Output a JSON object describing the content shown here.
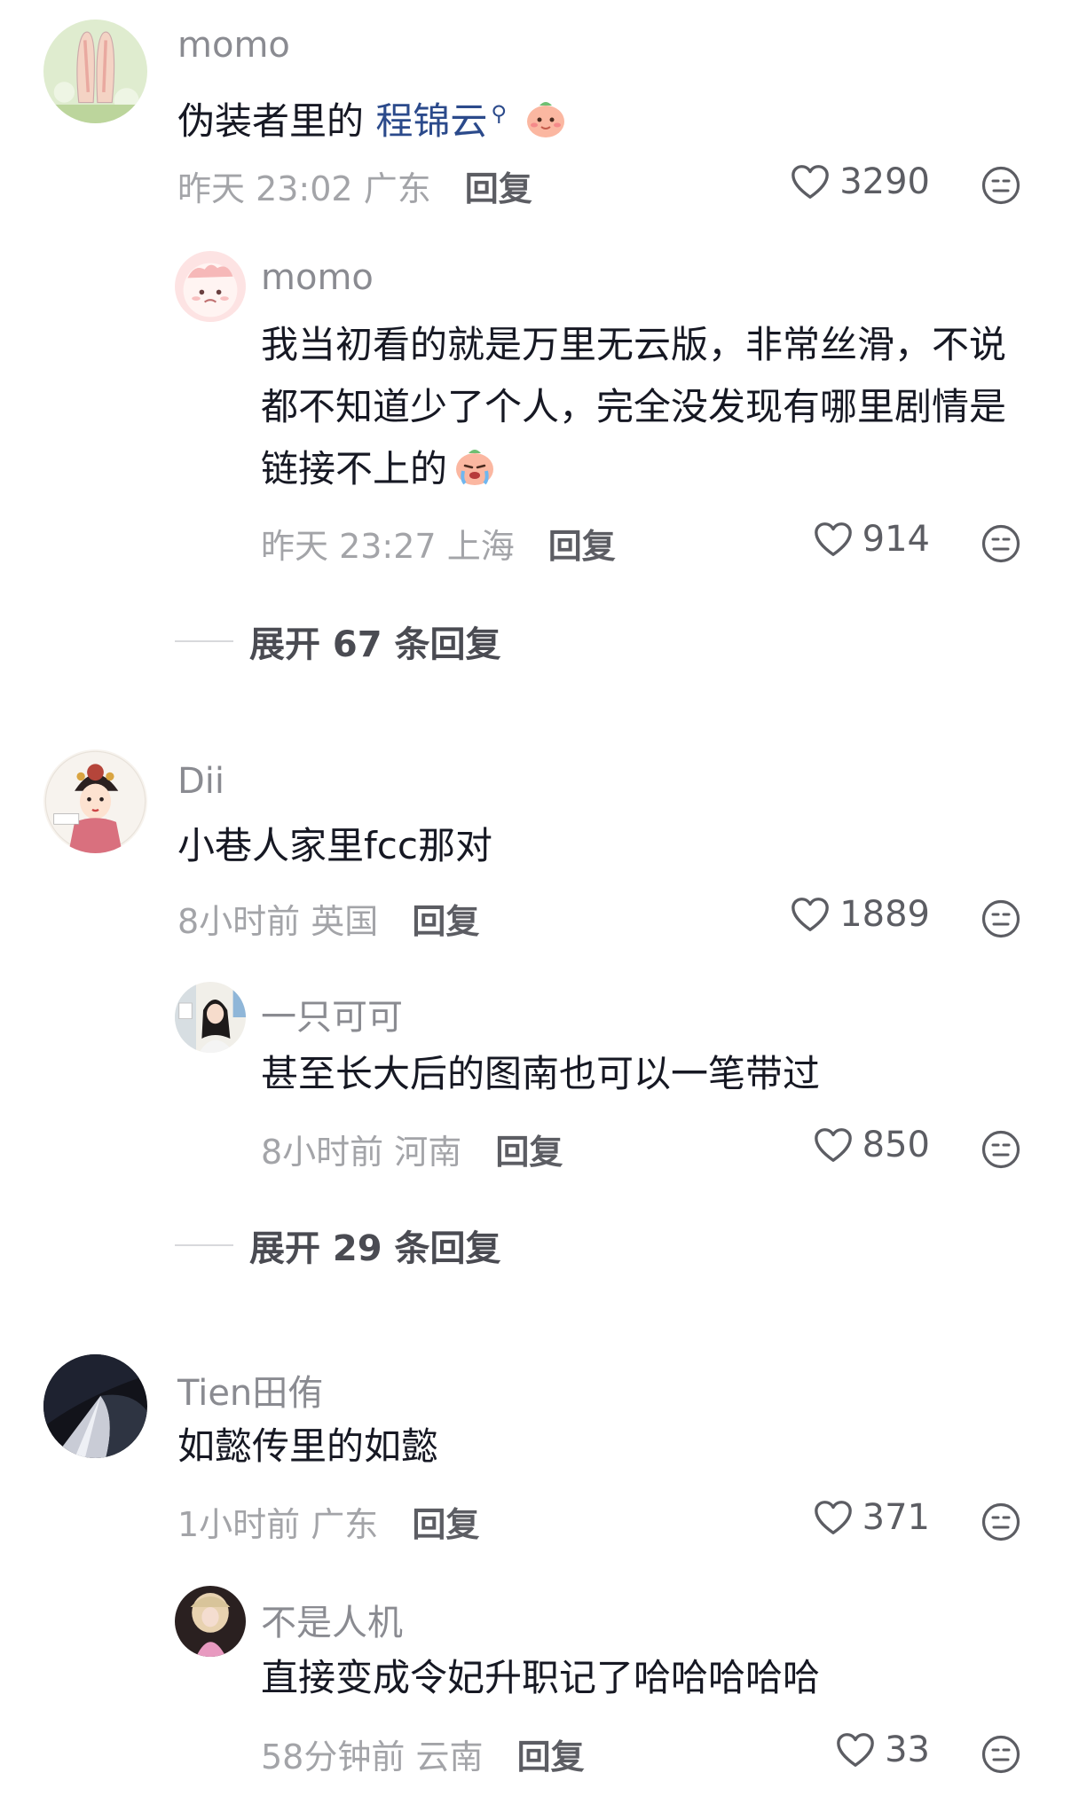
{
  "comments": [
    {
      "username": "momo",
      "text_plain": "伪装者里的 ",
      "mention": "程锦云",
      "time": "昨天 23:02",
      "location": "广东",
      "reply_label": "回复",
      "likes": "3290",
      "replies": [
        {
          "username": "momo",
          "text": "我当初看的就是万里无云版，非常丝滑，不说都不知道少了个人，完全没发现有哪里剧情是链接不上的",
          "time": "昨天 23:27",
          "location": "上海",
          "reply_label": "回复",
          "likes": "914"
        }
      ],
      "expand_label": "展开 67 条回复"
    },
    {
      "username": "Dii",
      "text": "小巷人家里fcc那对",
      "time": "8小时前",
      "location": "英国",
      "reply_label": "回复",
      "likes": "1889",
      "replies": [
        {
          "username": "一只可可",
          "text": "甚至长大后的图南也可以一笔带过",
          "time": "8小时前",
          "location": "河南",
          "reply_label": "回复",
          "likes": "850"
        }
      ],
      "expand_label": "展开 29 条回复"
    },
    {
      "username": "Tien田侑",
      "text": "如懿传里的如懿",
      "time": "1小时前",
      "location": "广东",
      "reply_label": "回复",
      "likes": "371",
      "replies": [
        {
          "username": "不是人机",
          "text": "直接变成令妃升职记了哈哈哈哈哈",
          "time": "58分钟前",
          "location": "云南",
          "reply_label": "回复",
          "likes": "33"
        }
      ]
    }
  ],
  "icons": {
    "like": "heart-outline-icon",
    "dislike": "neutral-face-icon",
    "search": "search-icon",
    "emoji": "blush-face-emoji"
  },
  "colors": {
    "text": "#161823",
    "meta": "#a3a4a8",
    "mention": "#2b4a8b",
    "username": "#8a8b91"
  }
}
